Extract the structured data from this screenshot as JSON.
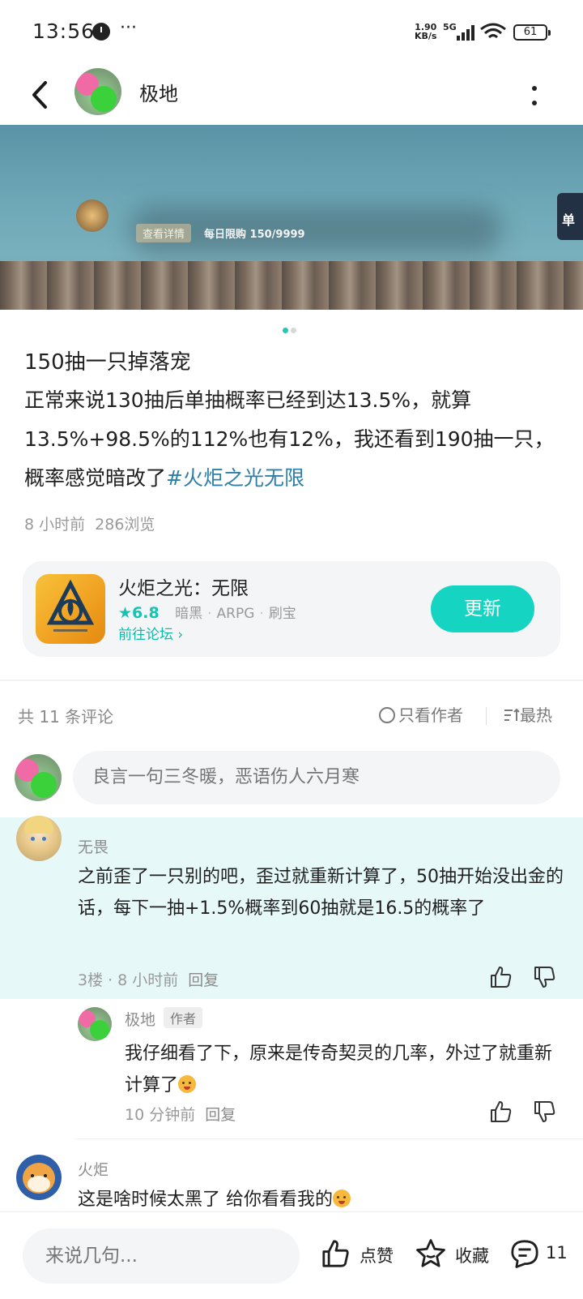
{
  "status_bar": {
    "time": "13:56",
    "dots": "···",
    "net_speed_value": "1.90",
    "net_speed_unit": "KB/s",
    "network": "5G",
    "battery": "61"
  },
  "header": {
    "title": "极地"
  },
  "banner": {
    "button_text": "查看详情",
    "counter_text": "每日限购 150/9999",
    "right_text": "单"
  },
  "post": {
    "title": "150抽一只掉落宠",
    "body": "正常来说130抽后单抽概率已经到达13.5%，就算13.5%+98.5%的112%也有12%，我还看到190抽一只，概率感觉暗改了",
    "hashtag": "#火炬之光无限",
    "time": "8 小时前",
    "views": "286浏览"
  },
  "game_card": {
    "name": "火炬之光：无限",
    "rating": "6.8",
    "tags": [
      "暗黑",
      "ARPG",
      "刷宝"
    ],
    "forum_link": "前往论坛",
    "button_label": "更新"
  },
  "comments_header": {
    "count": "共 11 条评论",
    "only_author": "只看作者",
    "sort": "最热"
  },
  "comment_input": {
    "placeholder": "良言一句三冬暖，恶语伤人六月寒"
  },
  "comments": [
    {
      "author": "无畏",
      "text": "之前歪了一只别的吧，歪过就重新计算了，50抽开始没出金的话，每下一抽+1.5%概率到60抽就是16.5的概率了",
      "floor": "3楼",
      "time": "8 小时前",
      "reply_label": "回复"
    },
    {
      "author": "极地",
      "tag": "作者",
      "text": "我仔细看了下，原来是传奇契灵的几率，外过了就重新计算了",
      "time": "10 分钟前",
      "reply_label": "回复"
    },
    {
      "author": "火炬",
      "text": "这是啥时候太黑了 给你看看我的"
    }
  ],
  "bottom_bar": {
    "input_placeholder": "来说几句...",
    "like_label": "点赞",
    "favorite_label": "收藏",
    "comment_count": "11"
  },
  "colors": {
    "accent": "#15d4c2",
    "hashtag": "#2e7fa8",
    "highlight_bg": "#e6f8f8",
    "muted_text": "#9a9a9a"
  },
  "icons": {
    "back": "chevron-left-icon",
    "more": "vertical-dots-icon",
    "like": "thumbs-up-icon",
    "dislike": "thumbs-down-icon",
    "favorite": "star-icon",
    "comment": "chat-bubble-icon",
    "sort": "sort-icon"
  }
}
